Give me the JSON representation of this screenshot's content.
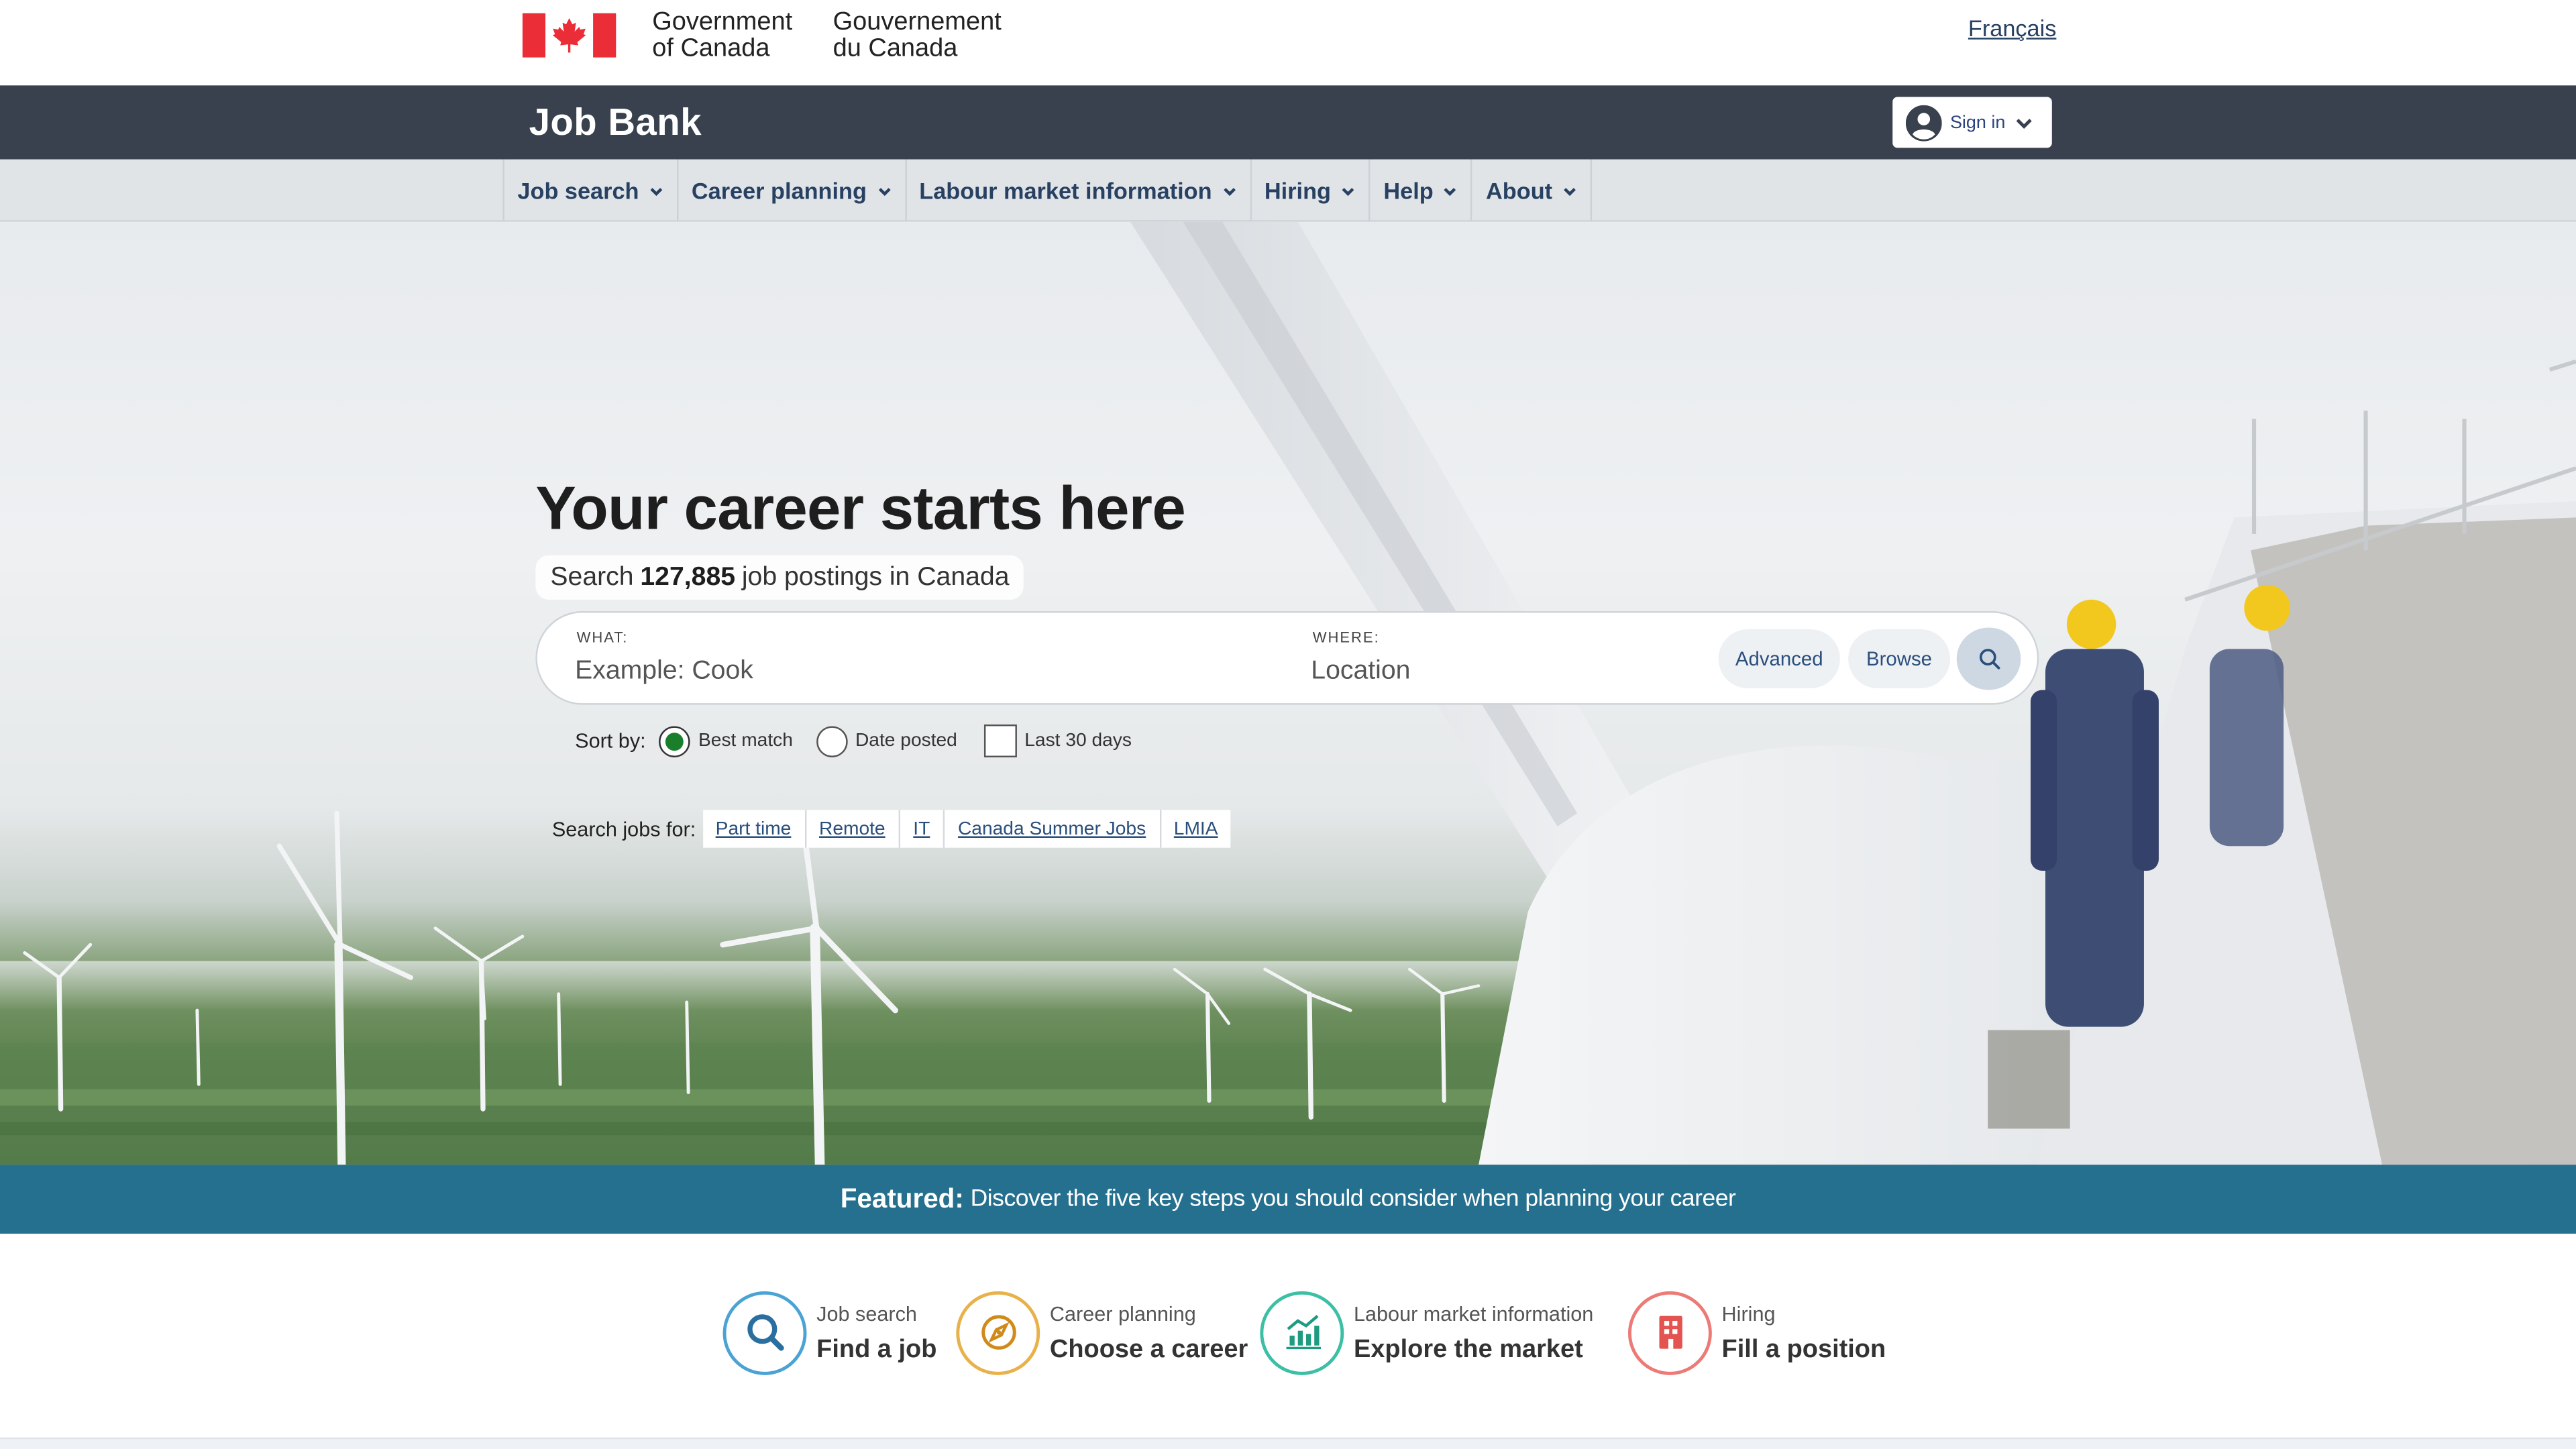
{
  "gov": {
    "en_line1": "Government",
    "en_line2": "of Canada",
    "fr_line1": "Gouvernement",
    "fr_line2": "du Canada",
    "language_toggle": "Français"
  },
  "app": {
    "title": "Job Bank",
    "signin_label": "Sign in"
  },
  "nav": {
    "items": [
      {
        "label": "Job search"
      },
      {
        "label": "Career planning"
      },
      {
        "label": "Labour market information"
      },
      {
        "label": "Hiring"
      },
      {
        "label": "Help"
      },
      {
        "label": "About"
      }
    ]
  },
  "hero": {
    "title": "Your career starts here",
    "count_prefix": "Search",
    "count_value": "127,885",
    "count_suffix": "job postings in Canada",
    "search": {
      "what_label": "WHAT:",
      "what_placeholder": "Example: Cook",
      "where_label": "WHERE:",
      "where_placeholder": "Location",
      "advanced_label": "Advanced",
      "browse_label": "Browse"
    },
    "sort": {
      "label": "Sort by:",
      "options": [
        {
          "label": "Best match",
          "selected": true
        },
        {
          "label": "Date posted",
          "selected": false
        }
      ],
      "last30_label": "Last 30 days",
      "last30_checked": false
    },
    "quick_search": {
      "label": "Search jobs for:",
      "links": [
        "Part time",
        "Remote",
        "IT",
        "Canada Summer Jobs",
        "LMIA"
      ]
    }
  },
  "featured": {
    "label": "Featured:",
    "text": "Discover the five key steps you should consider when planning your career"
  },
  "quick_access": [
    {
      "small": "Job search",
      "big": "Find a job",
      "icon": "search-icon",
      "color": "#3a8fc4"
    },
    {
      "small": "Career planning",
      "big": "Choose a career",
      "icon": "compass-icon",
      "color": "#e0a02a"
    },
    {
      "small": "Labour market information",
      "big": "Explore the market",
      "icon": "chart-icon",
      "color": "#2aa88f"
    },
    {
      "small": "Hiring",
      "big": "Fill a position",
      "icon": "building-icon",
      "color": "#e3534f"
    }
  ],
  "colors": {
    "app_bar": "#38414d",
    "nav_bg": "#e1e4e7",
    "link": "#284162",
    "featured_bg": "#26708f",
    "flag_red": "#eb2d37"
  }
}
